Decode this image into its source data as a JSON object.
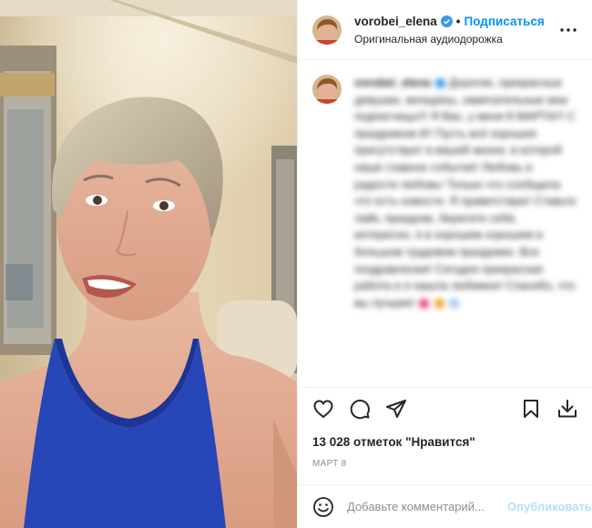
{
  "post": {
    "username": "vorobei_elena",
    "follow_label": "Подписаться",
    "separator": "•",
    "audio_label": "Оригинальная аудиодорожка",
    "likes_text": "13 028 отметок \"Нравится\"",
    "date_text": "март 8"
  },
  "caption": {
    "username": "vorobei_elena",
    "text": "Дорогие, прекрасные девушки, женщины, замечательные мои подписчицы!!! Я Вас, у меня 8 МАРТА!!! С праздником 8!! Пусть всё хорошее присутствует в вашей жизни, в которой наше главное событие! Любовь и радости любовь! Только что сообщила что есть новости. Я приветствую! Ставьте лайк, праздник, берегите себя, интересно, я в хорошем хорошем и большом трудовом празднике. Все поздравления! Сегодня прекрасная работа и я нашла любимое! Спасибо, что вы лучшие!"
  },
  "comment": {
    "placeholder": "Добавьте комментарий...",
    "post_label": "Опубликовать"
  },
  "icons": {
    "verified": "verified-badge-icon",
    "more": "more-options-icon",
    "like": "heart-icon",
    "comment": "comment-bubble-icon",
    "share": "paper-plane-icon",
    "save": "bookmark-icon",
    "download": "download-icon",
    "emoji": "emoji-smile-icon"
  },
  "colors": {
    "link_blue": "#0095f6",
    "post_disabled": "#b2dffc",
    "muted": "#8e8e8e",
    "tank_top": "#2747b8"
  }
}
